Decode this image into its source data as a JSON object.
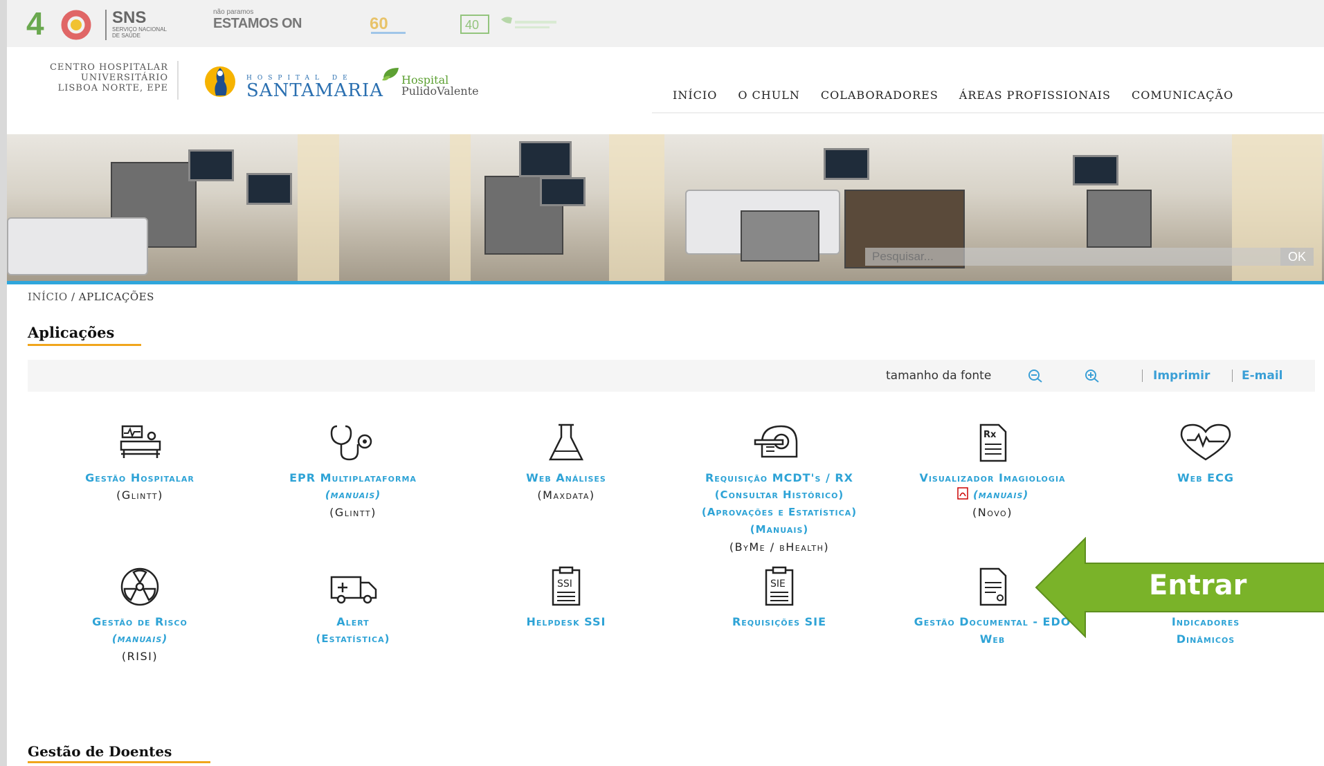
{
  "topbar": {
    "sns_title": "SNS",
    "sns_sub1": "SERVIÇO NACIONAL",
    "sns_sub2": "DE SAÚDE",
    "estamos_small": "não paramos",
    "estamos_big": "ESTAMOS ON",
    "forty": "40"
  },
  "header": {
    "chln": [
      "CENTRO HOSPITALAR",
      "UNIVERSITÁRIO",
      "LISBOA NORTE, EPE"
    ],
    "hsm_small": "HOSPITAL DE",
    "hsm_big": "SANTAMARIA",
    "hpv_line1": "Hospital",
    "hpv_line2": "PulidoValente"
  },
  "nav": [
    "INÍCIO",
    "O CHULN",
    "COLABORADORES",
    "ÁREAS PROFISSIONAIS",
    "COMUNICAÇÃO"
  ],
  "search": {
    "placeholder": "Pesquisar...",
    "ok": "OK"
  },
  "breadcrumb": {
    "home": "INÍCIO",
    "separator": " / ",
    "current": "APLICAÇÕES"
  },
  "page_title": "Aplicações",
  "toolbar": {
    "font_size_label": "tamanho da fonte",
    "print": "Imprimir",
    "email": "E-mail"
  },
  "apps": [
    {
      "name": "Gestão Hospitalar",
      "sub": "(Glintt)",
      "icon": "hospital-bed-icon"
    },
    {
      "name": "EPR Multiplataforma",
      "link": "(manuais)",
      "sub": "(Glintt)",
      "icon": "stethoscope-icon"
    },
    {
      "name": "Web Análises",
      "sub": "(Maxdata)",
      "icon": "flask-icon"
    },
    {
      "name": "Requisição MCDT's / RX",
      "links": [
        "(Consultar Histórico)",
        "(Aprovações e Estatística)",
        "(Manuais)"
      ],
      "sub": "(ByMe / bHealth)",
      "icon": "ct-scanner-icon"
    },
    {
      "name": "Visualizador Imagiologia",
      "link": "(manuais)",
      "sub": "(Novo)",
      "icon": "rx-document-icon"
    },
    {
      "name": "Web ECG",
      "icon": "heart-ecg-icon"
    },
    {
      "name": "Gestão de Risco",
      "link": "(manuais)",
      "sub": "(RISI)",
      "icon": "radiation-icon"
    },
    {
      "name": "Alert",
      "link": "(Estatística)",
      "icon": "ambulance-icon"
    },
    {
      "name": "Helpdesk SSI",
      "icon": "ssi-clipboard-icon"
    },
    {
      "name": "Requisições SIE",
      "icon": "sie-clipboard-icon"
    },
    {
      "name": "Gestão Documental - EDO",
      "name2": "Web",
      "icon": "document-icon"
    },
    {
      "name": "Indicadores",
      "name2": "Dinâmicos",
      "icon": ""
    }
  ],
  "arrow_label": "Entrar",
  "section2_title": "Gestão de Doentes",
  "colors": {
    "accent": "#2ea3d6",
    "underline": "#f0a51c",
    "arrow": "#7ab329"
  }
}
